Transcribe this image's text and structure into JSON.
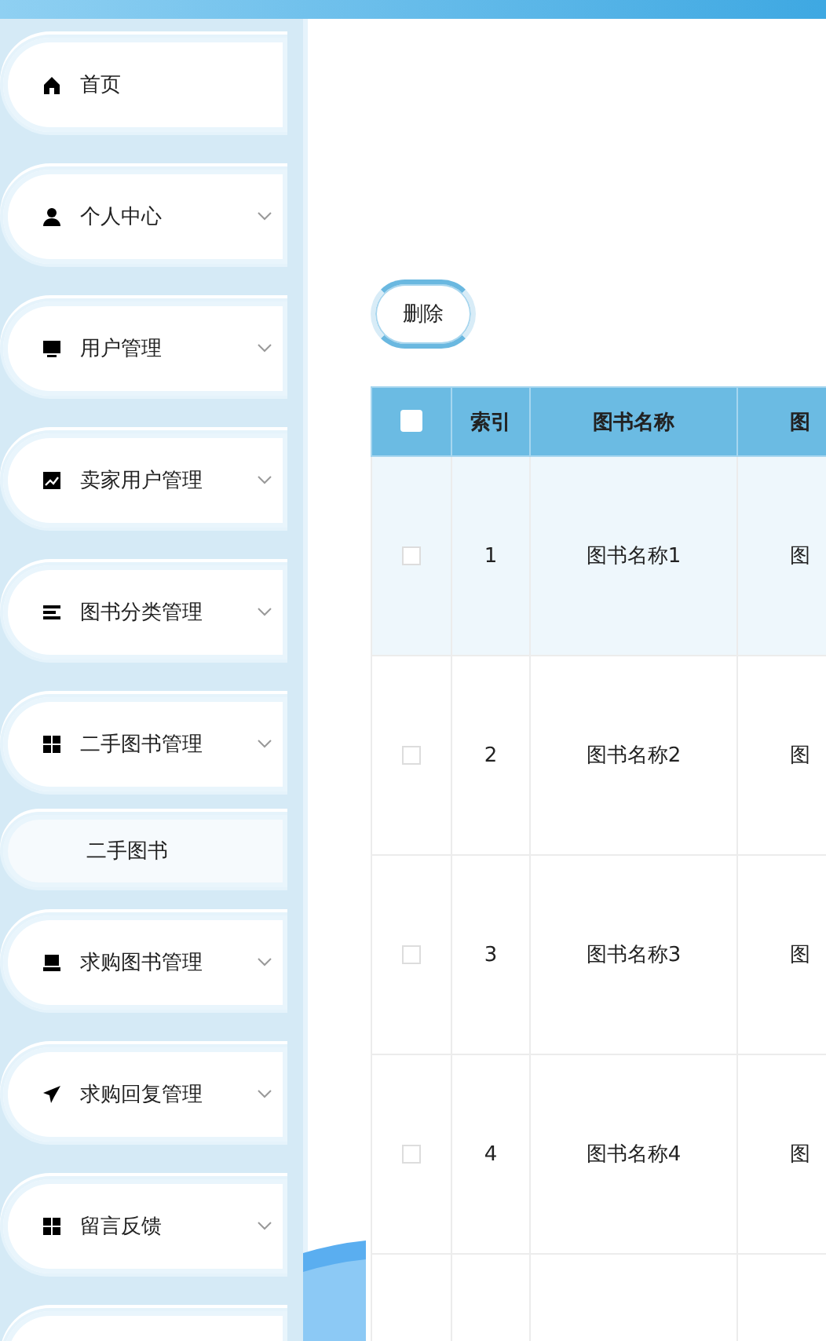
{
  "sidebar": {
    "items": [
      {
        "label": "首页",
        "expandable": false
      },
      {
        "label": "个人中心",
        "expandable": true
      },
      {
        "label": "用户管理",
        "expandable": true
      },
      {
        "label": "卖家用户管理",
        "expandable": true
      },
      {
        "label": "图书分类管理",
        "expandable": true
      },
      {
        "label": "二手图书管理",
        "expandable": true,
        "children": [
          {
            "label": "二手图书"
          }
        ]
      },
      {
        "label": "求购图书管理",
        "expandable": true
      },
      {
        "label": "求购回复管理",
        "expandable": true
      },
      {
        "label": "留言反馈",
        "expandable": true
      }
    ]
  },
  "toolbar": {
    "buttons": [
      "删除"
    ]
  },
  "table": {
    "header_checkbox": {
      "checked": false
    },
    "columns": [
      "索引",
      "图书名称",
      "图"
    ],
    "rows": [
      {
        "selected": true,
        "checked": false,
        "cells": [
          "1",
          "图书名称1",
          "图"
        ]
      },
      {
        "selected": false,
        "checked": false,
        "cells": [
          "2",
          "图书名称2",
          "图"
        ]
      },
      {
        "selected": false,
        "checked": false,
        "cells": [
          "3",
          "图书名称3",
          "图"
        ]
      },
      {
        "selected": false,
        "checked": false,
        "cells": [
          "4",
          "图书名称4",
          "图"
        ]
      }
    ]
  }
}
